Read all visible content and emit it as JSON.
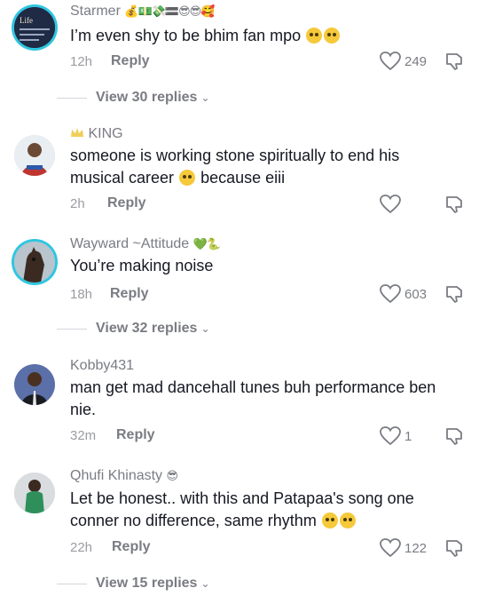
{
  "comments": [
    {
      "username": "Starmer",
      "badge": "💰💵💸🟰😎😎🥰",
      "text": "I’m even shy to be bhim fan mpo",
      "time": "12h",
      "reply_label": "Reply",
      "likes": "249",
      "view_replies": "View 30 replies",
      "avatar_text": "Life"
    },
    {
      "username": "KING",
      "text": "someone is working stone spiritually to end his musical career",
      "text_tail": "because eiii",
      "time": "2h",
      "reply_label": "Reply",
      "likes": ""
    },
    {
      "username": "Wayward ~Attitude",
      "badge": "💚🐍",
      "text": "You’re making noise",
      "time": "18h",
      "reply_label": "Reply",
      "likes": "603",
      "view_replies": "View 32 replies"
    },
    {
      "username": "Kobby431",
      "text": "man get mad dancehall tunes buh performance ben nie.",
      "time": "32m",
      "reply_label": "Reply",
      "likes": "1"
    },
    {
      "username": "Qhufi Khinasty",
      "badge": "😎",
      "text": "Let be honest.. with this and Patapaa's song one conner no difference, same rhythm",
      "time": "22h",
      "reply_label": "Reply",
      "likes": "122",
      "view_replies": "View 15 replies"
    }
  ],
  "colors": {
    "text": "#161823",
    "muted": "#7a7c83",
    "avatar_ring": "#2fc6e0"
  }
}
